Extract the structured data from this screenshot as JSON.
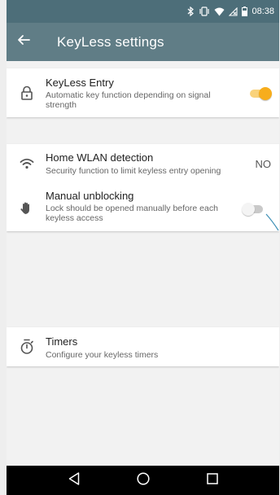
{
  "status_bar": {
    "time": "08:38",
    "icons": [
      "bluetooth-icon",
      "vibrate-icon",
      "wifi-icon",
      "no-sim-icon",
      "battery-icon"
    ]
  },
  "app_bar": {
    "back_icon": "arrow-left-icon",
    "title": "KeyLess settings"
  },
  "colors": {
    "status_bar": "#4d6e79",
    "app_bar": "#607d86",
    "accent": "#f7ad1c",
    "background": "#f2f2f2"
  },
  "settings": {
    "keyless_entry": {
      "icon": "lock-icon",
      "title": "KeyLess Entry",
      "subtitle": "Automatic key function depending on signal strength",
      "enabled": true
    },
    "home_wlan": {
      "icon": "wifi-icon",
      "title": "Home WLAN detection",
      "subtitle": "Security function to limit keyless entry opening",
      "value": "NO"
    },
    "manual_unblocking": {
      "icon": "hand-icon",
      "title": "Manual unblocking",
      "subtitle": "Lock should be opened manually before each keyless access",
      "enabled": false
    },
    "timers": {
      "icon": "stopwatch-icon",
      "title": "Timers",
      "subtitle": "Configure your keyless timers"
    }
  },
  "nav_bar": {
    "icons": [
      "back-triangle-icon",
      "home-circle-icon",
      "recents-square-icon"
    ]
  }
}
